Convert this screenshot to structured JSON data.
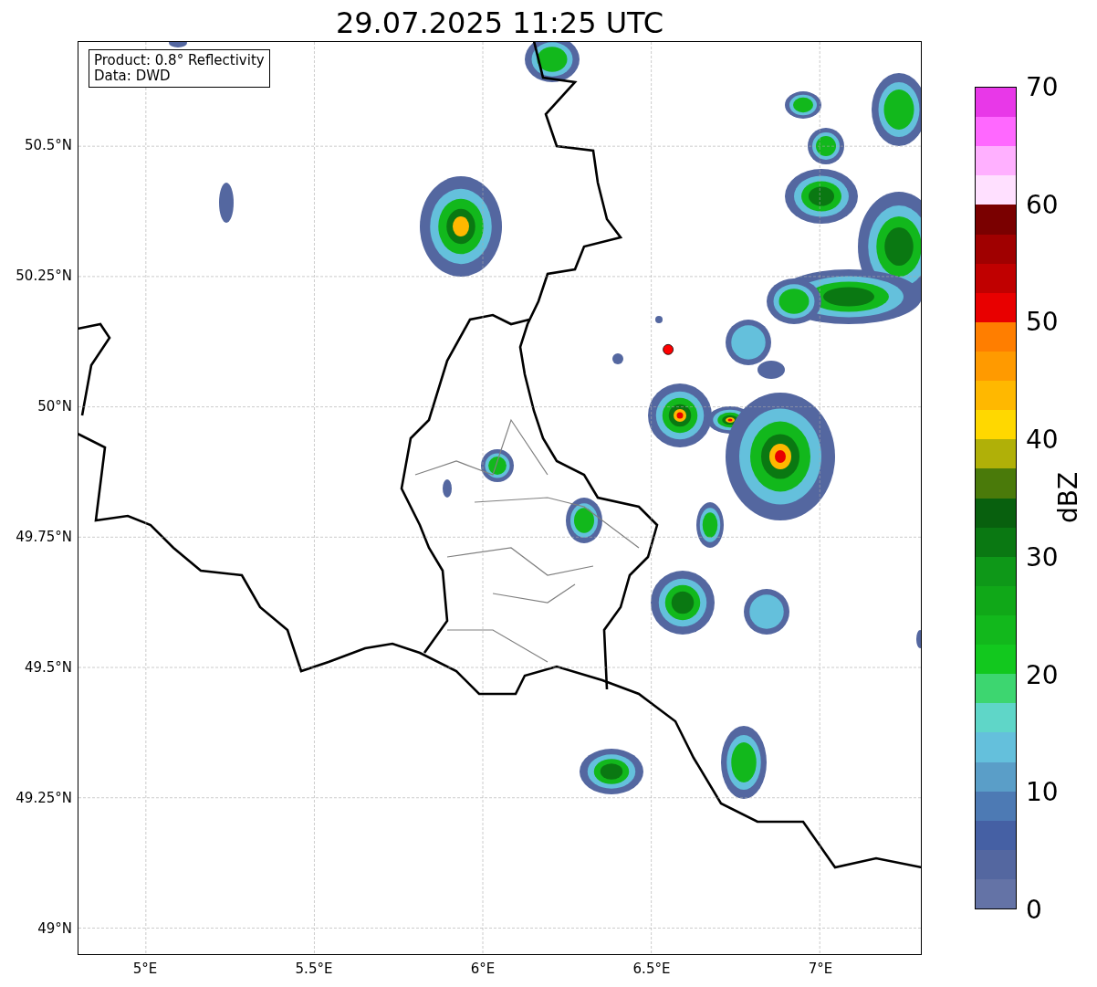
{
  "title": "29.07.2025 11:25 UTC",
  "map": {
    "legend": [
      "Product: 0.8° Reflectivity",
      "Data: DWD"
    ],
    "chart_data": {
      "type": "scatter",
      "xlim": [
        4.8,
        7.3
      ],
      "ylim": [
        48.95,
        50.7
      ],
      "xticks": [
        {
          "value": 5,
          "label": "5°E"
        },
        {
          "value": 5.5,
          "label": "5.5°E"
        },
        {
          "value": 6,
          "label": "6°E"
        },
        {
          "value": 6.5,
          "label": "6.5°E"
        },
        {
          "value": 7,
          "label": "7°E"
        }
      ],
      "yticks": [
        {
          "value": 49,
          "label": "49°N"
        },
        {
          "value": 49.25,
          "label": "49.25°N"
        },
        {
          "value": 49.5,
          "label": "49.5°N"
        },
        {
          "value": 49.75,
          "label": "49.75°N"
        },
        {
          "value": 50,
          "label": "50°N"
        },
        {
          "value": 50.25,
          "label": "50.25°N"
        },
        {
          "value": 50.5,
          "label": "50.5°N"
        }
      ],
      "grid": true,
      "x": [
        6.55
      ],
      "series": [
        {
          "color": "#ff0000",
          "values": [
            50.11
          ]
        }
      ]
    }
  },
  "colorbar": {
    "label": "dBZ",
    "ticks": [
      "70",
      "60",
      "50",
      "40",
      "30",
      "20",
      "10",
      "0"
    ],
    "bins": [
      {
        "color": "#e838e8"
      },
      {
        "color": "#ff68ff"
      },
      {
        "color": "#ffb0ff"
      },
      {
        "color": "#ffe0ff"
      },
      {
        "color": "#7a0000"
      },
      {
        "color": "#a00000"
      },
      {
        "color": "#c00000"
      },
      {
        "color": "#e80000"
      },
      {
        "color": "#ff7e00"
      },
      {
        "color": "#ff9a00"
      },
      {
        "color": "#ffb800"
      },
      {
        "color": "#ffd800"
      },
      {
        "color": "#b0b008"
      },
      {
        "color": "#4a7a0a"
      },
      {
        "color": "#08600e"
      },
      {
        "color": "#0a7812"
      },
      {
        "color": "#0e9818"
      },
      {
        "color": "#10a818"
      },
      {
        "color": "#12b81c"
      },
      {
        "color": "#12c81e"
      },
      {
        "color": "#3dd670"
      },
      {
        "color": "#5fd6c8"
      },
      {
        "color": "#64c0dc"
      },
      {
        "color": "#5a9ec8"
      },
      {
        "color": "#4d7ab4"
      },
      {
        "color": "#4560a4"
      },
      {
        "color": "#5467a0"
      },
      {
        "color": "#6473a6"
      }
    ]
  }
}
